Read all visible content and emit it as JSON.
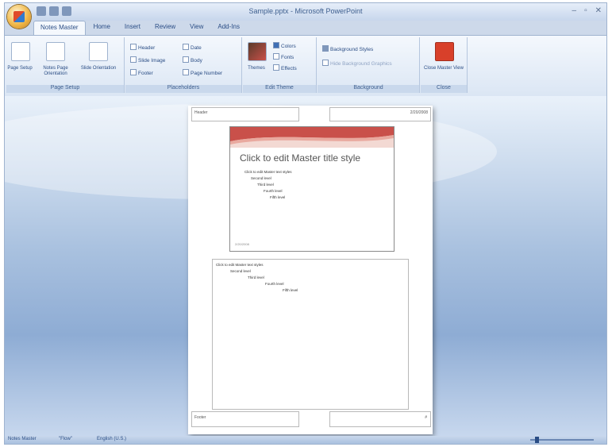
{
  "window": {
    "title": "Sample.pptx - Microsoft PowerPoint",
    "controls": [
      "–",
      "▫",
      "✕"
    ]
  },
  "ribbon": {
    "tabs": [
      "Notes Master",
      "Home",
      "Insert",
      "Review",
      "View",
      "Add-Ins"
    ],
    "page_setup": {
      "label": "Page Setup",
      "buttons": [
        "Page Setup",
        "Notes Page Orientation",
        "Slide Orientation"
      ]
    },
    "placeholders": {
      "label": "Placeholders",
      "checks": [
        "Header",
        "Slide Image",
        "Footer",
        "Date",
        "Body",
        "Page Number"
      ]
    },
    "edit_theme": {
      "label": "Edit Theme",
      "buttons": [
        "Themes",
        "Colors",
        "Fonts",
        "Effects"
      ]
    },
    "background": {
      "label": "Background",
      "buttons": [
        "Background Styles",
        "Hide Background Graphics"
      ]
    },
    "close": {
      "label": "Close",
      "button": "Close Master View"
    }
  },
  "notes_page": {
    "header": "Header",
    "date": "2/20/2008",
    "footer": "Footer",
    "page_number": "#",
    "slide": {
      "title": "Click to edit Master title style",
      "bullets": [
        "Click to edit Master text styles",
        "Second level",
        "Third level",
        "Fourth level",
        "Fifth level"
      ],
      "date_placeholder": "2/20/2008"
    },
    "notes_bullets": [
      "Click to edit Master text styles",
      "Second level",
      "Third level",
      "Fourth level",
      "Fifth level"
    ]
  },
  "status_bar": {
    "view": "Notes Master",
    "theme": "\"Flow\"",
    "language": "English (U.S.)",
    "zoom_percent": 40
  },
  "colors": {
    "ribbon_text": "#2a4d85",
    "slide_accent": "#c9504a"
  }
}
